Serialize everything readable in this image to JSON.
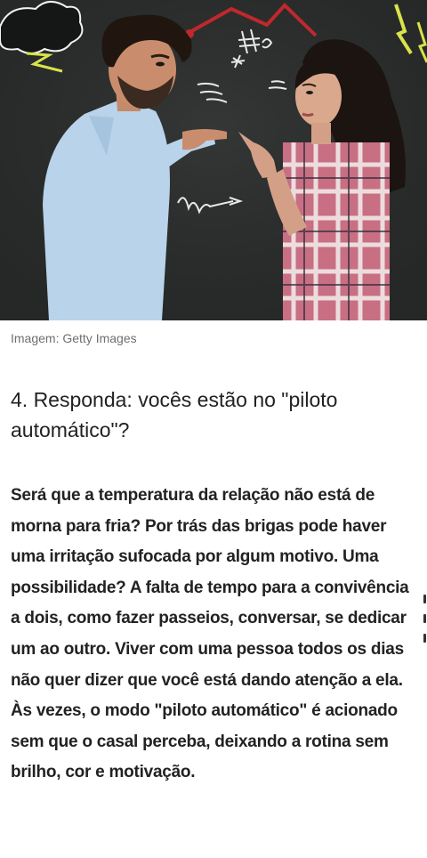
{
  "image": {
    "alt": "",
    "caption": "Imagem: Getty Images"
  },
  "article": {
    "heading": "4. Responda: vocês estão no \"piloto automático\"?",
    "body": "Será que a temperatura da relação não está de morna para fria? Por trás das brigas pode haver uma irritação sufocada por algum motivo. Uma possibilidade? A falta de tempo para a convivência a dois, como fazer passeios, conversar, se dedicar um ao outro. Viver com uma pessoa todos os dias não quer dizer que você está dando atenção a ela. Às vezes, o modo \"piloto automático\" é acionado sem que o casal perceba, deixando a rotina sem brilho, cor e motivação."
  },
  "colors": {
    "chalkboard": "#2a2d2c",
    "chalk_yellow": "#d9e34a",
    "chalk_red": "#c0282c",
    "shirt_blue": "#b9d3ea",
    "text": "#222222",
    "caption": "#6f6f6f"
  }
}
